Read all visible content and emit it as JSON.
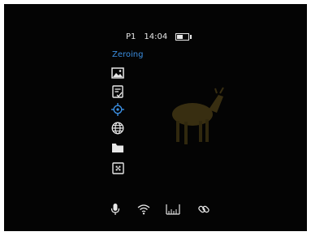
{
  "status": {
    "profile": "P1",
    "time": "14:04",
    "battery_level": 0.55
  },
  "menu": {
    "title": "Zeroing",
    "items": [
      {
        "icon": "image-icon",
        "active": false
      },
      {
        "icon": "settings-card-icon",
        "active": false
      },
      {
        "icon": "crosshair-icon",
        "active": true
      },
      {
        "icon": "globe-icon",
        "active": false
      },
      {
        "icon": "folder-icon",
        "active": false
      },
      {
        "icon": "target-box-icon",
        "active": false
      }
    ]
  },
  "bottom_bar": {
    "items": [
      {
        "icon": "microphone-icon"
      },
      {
        "icon": "wifi-icon"
      },
      {
        "icon": "rangefinder-ruler-icon"
      },
      {
        "icon": "link-icon"
      }
    ]
  },
  "colors": {
    "accent": "#3b8ee0",
    "icon": "#e8e8e8",
    "background": "#040404"
  }
}
